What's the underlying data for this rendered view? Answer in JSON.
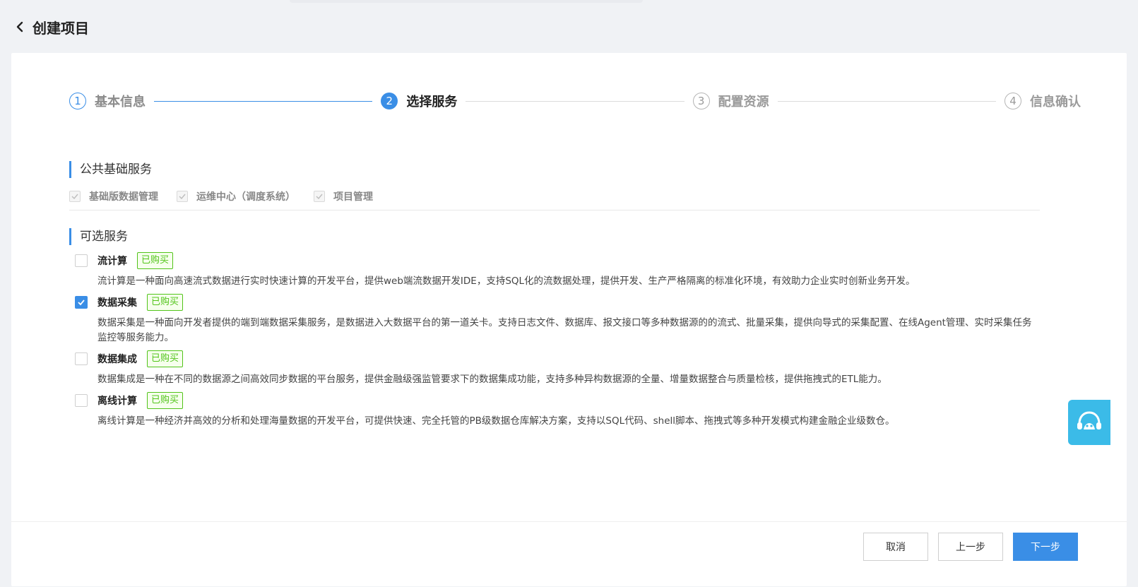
{
  "page": {
    "title": "创建项目"
  },
  "steps": [
    {
      "num": "1",
      "label": "基本信息",
      "state": "done"
    },
    {
      "num": "2",
      "label": "选择服务",
      "state": "active"
    },
    {
      "num": "3",
      "label": "配置资源",
      "state": "todo"
    },
    {
      "num": "4",
      "label": "信息确认",
      "state": "todo"
    }
  ],
  "public_section": {
    "title": "公共基础服务",
    "items": [
      {
        "label": "基础版数据管理",
        "checked": true,
        "disabled": true
      },
      {
        "label": "运维中心（调度系统）",
        "checked": true,
        "disabled": true
      },
      {
        "label": "项目管理",
        "checked": true,
        "disabled": true
      }
    ]
  },
  "optional_section": {
    "title": "可选服务",
    "items": [
      {
        "name": "流计算",
        "badge": "已购买",
        "checked": false,
        "desc": "流计算是一种面向高速流式数据进行实时快速计算的开发平台，提供web端流数据开发IDE，支持SQL化的流数据处理，提供开发、生产严格隔离的标准化环境，有效助力企业实时创新业务开发。"
      },
      {
        "name": "数据采集",
        "badge": "已购买",
        "checked": true,
        "desc": "数据采集是一种面向开发者提供的端到端数据采集服务，是数据进入大数据平台的第一道关卡。支持日志文件、数据库、报文接口等多种数据源的的流式、批量采集，提供向导式的采集配置、在线Agent管理、实时采集任务监控等服务能力。"
      },
      {
        "name": "数据集成",
        "badge": "已购买",
        "checked": false,
        "desc": "数据集成是一种在不同的数据源之间高效同步数据的平台服务，提供金融级强监管要求下的数据集成功能，支持多种异构数据源的全量、增量数据整合与质量检核，提供拖拽式的ETL能力。"
      },
      {
        "name": "离线计算",
        "badge": "已购买",
        "checked": false,
        "desc": "离线计算是一种经济并高效的分析和处理海量数据的开发平台，可提供快速、完全托管的PB级数据仓库解决方案，支持以SQL代码、shell脚本、拖拽式等多种开发模式构建金融企业级数仓。"
      }
    ]
  },
  "footer": {
    "cancel": "取消",
    "prev": "上一步",
    "next": "下一步"
  },
  "colors": {
    "accent": "#3a8ee6",
    "badge_green": "#52c41a",
    "float_button": "#3bbbe8"
  },
  "icons": {
    "back": "chevron-left-icon",
    "float": "customer-service-icon"
  }
}
